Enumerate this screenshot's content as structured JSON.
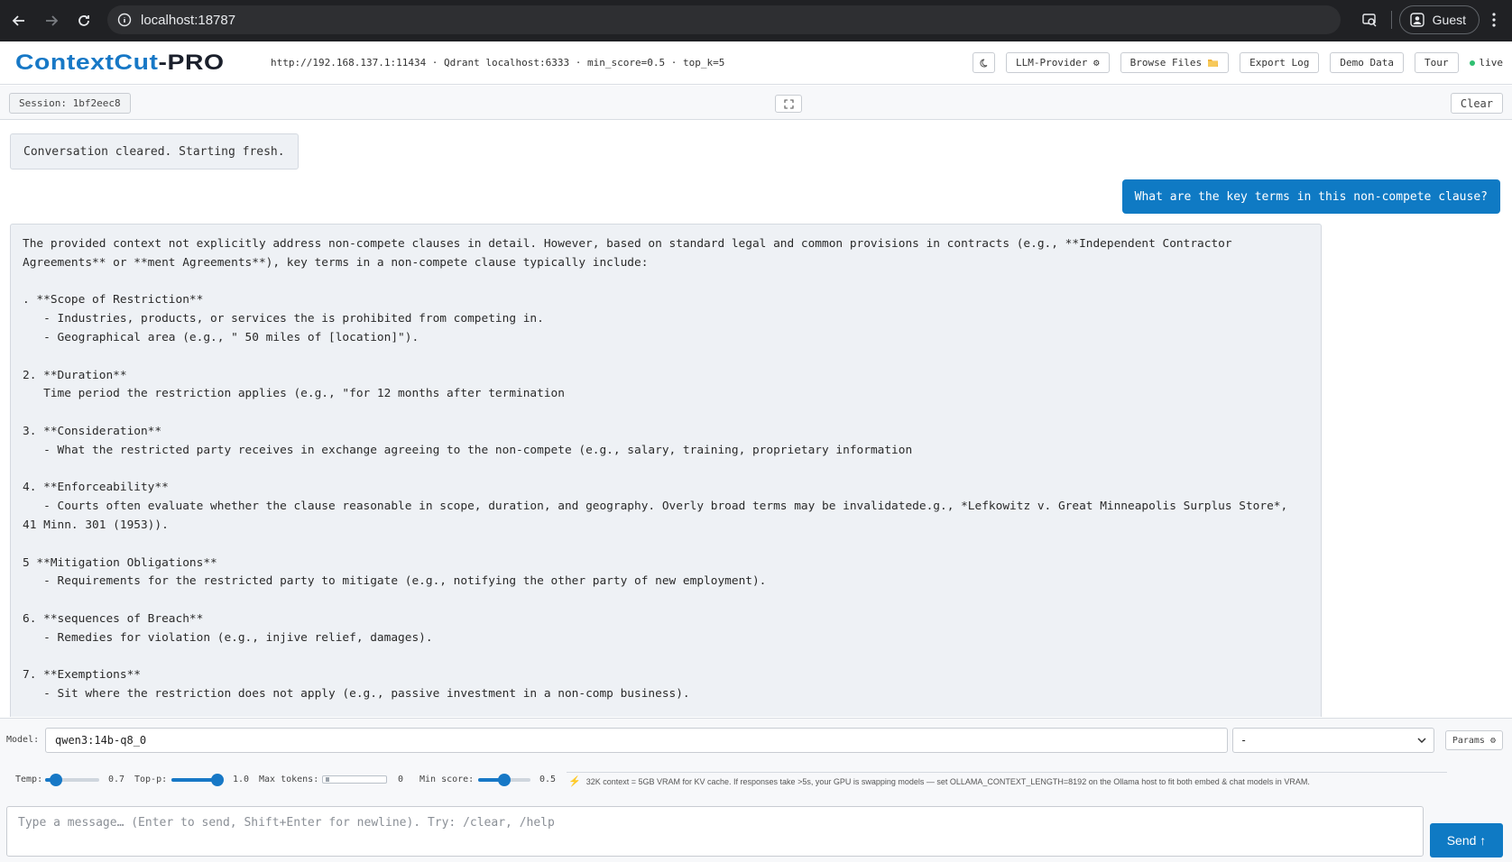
{
  "browser": {
    "url": "localhost:18787",
    "profile_label": "Guest"
  },
  "app": {
    "logo_main": "ContextCut",
    "logo_suffix": "-PRO",
    "endpoint_info": "http://192.168.137.1:11434 · Qdrant localhost:6333 · min_score=0.5 · top_k=5",
    "buttons": {
      "llm_provider": "LLM-Provider ⚙",
      "browse_files": "Browse Files",
      "export_log": "Export Log",
      "demo_data": "Demo Data",
      "tour": "Tour"
    },
    "status": "live"
  },
  "session": {
    "label": "Session: 1bf2eec8",
    "clear_label": "Clear"
  },
  "chat": {
    "system_message": "Conversation cleared. Starting fresh.",
    "user_message": "What are the key terms in this non-compete clause?",
    "assistant_message": "The provided context not explicitly address non-compete clauses in detail. However, based on standard legal and common provisions in contracts (e.g., **Independent Contractor\nAgreements** or **ment Agreements**), key terms in a non-compete clause typically include:\n\n. **Scope of Restriction**\n   - Industries, products, or services the is prohibited from competing in.\n   - Geographical area (e.g., \" 50 miles of [location]\").\n\n2. **Duration**\n   Time period the restriction applies (e.g., \"for 12 months after termination\n\n3. **Consideration**\n   - What the restricted party receives in exchange agreeing to the non-compete (e.g., salary, training, proprietary information\n\n4. **Enforceability**\n   - Courts often evaluate whether the clause reasonable in scope, duration, and geography. Overly broad terms may be invalidatede.g., *Lefkowitz v. Great Minneapolis Surplus Store*,\n41 Minn. 301 (1953)).\n\n5 **Mitigation Obligations**\n   - Requirements for the restricted party to mitigate (e.g., notifying the other party of new employment).\n\n6. **sequences of Breach**\n   - Remedies for violation (e.g., injive relief, damages).\n\n7. **Exemptions**\n   - Sit where the restriction does not apply (e.g., passive investment in a non-comp business)."
  },
  "model_bar": {
    "label": "Model:",
    "model_value": "qwen3:14b-q8_0",
    "select_value": "-",
    "params_label": "Params ⚙"
  },
  "sliders": {
    "temp": {
      "label": "Temp:",
      "value": "0.7",
      "fraction": 0.2
    },
    "top_p": {
      "label": "Top-p:",
      "value": "1.0",
      "fraction": 0.93
    },
    "max_tokens": {
      "label": "Max tokens:",
      "value": "0"
    },
    "min_score": {
      "label": "Min score:",
      "value": "0.5",
      "fraction": 0.5
    }
  },
  "vram_note": "32K context = 5GB VRAM for KV cache. If responses take >5s, your GPU is swapping models — set OLLAMA_CONTEXT_LENGTH=8192 on the Ollama host to fit both embed & chat models in VRAM.",
  "composer": {
    "placeholder": "Type a message… (Enter to send, Shift+Enter for newline). Try: /clear, /help",
    "send_label": "Send ↑"
  },
  "colors": {
    "accent": "#0f7ac4",
    "live": "#2fbf71",
    "bolt": "#e8a21b"
  }
}
